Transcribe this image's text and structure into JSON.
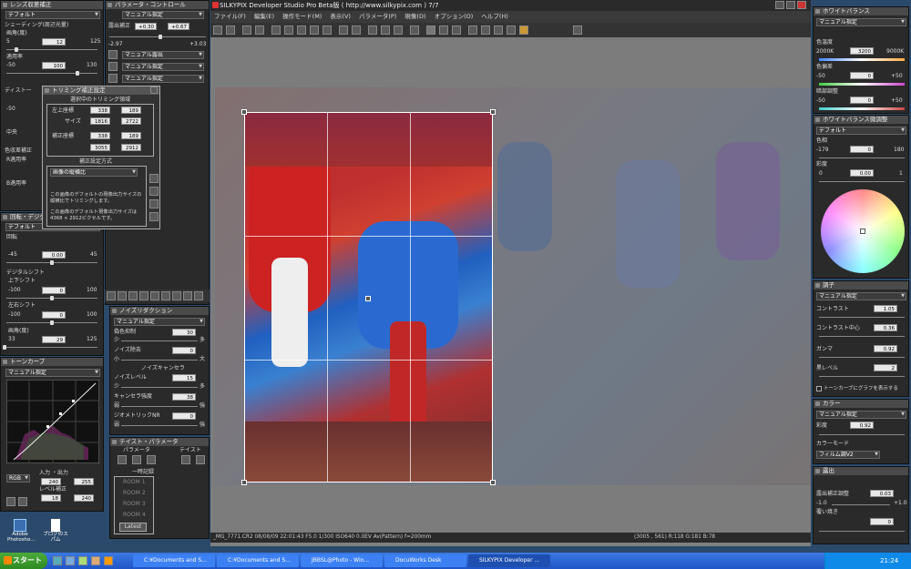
{
  "app": {
    "title": "SILKYPIX Developer Studio Pro Beta版 ( http://www.silkypix.com ) 7/7"
  },
  "menu": [
    "ファイル(F)",
    "編集(E)",
    "操作モード(M)",
    "表示(V)",
    "パラメータ(P)",
    "現像(D)",
    "オプション(O)",
    "ヘルプ(H)"
  ],
  "status": {
    "left": "_MG_7771.CR2 08/08/09 22:01:43 F5.0 1/300 ISO640 0.0EV Av(Pattern) f=200mm",
    "right": "(3005 , 561) R:118 G:181 B:78"
  },
  "lens": {
    "title": "レンズ収差補正",
    "preset": "デフォルト",
    "shading": "シェーディング(周辺光量)",
    "angle_label": "画角(度)",
    "angle_min": "5",
    "angle_val": "12",
    "angle_max": "125",
    "rate_label": "適用率",
    "rate_min": "-50",
    "rate_val": "100",
    "rate_max": "130",
    "distortion": "ディストー",
    "dist_min": "-50",
    "center": "中央",
    "chrom": "色収差補正",
    "r_rate": "R適用率",
    "b_rate": "B適用率"
  },
  "trim": {
    "title": "トリミング補正設定",
    "section": "選択中のトリミング領域",
    "tl_label": "左上座標",
    "tl_x": "338",
    "tl_y": "189",
    "size_label": "サイズ",
    "size_w": "1816",
    "size_h": "2722",
    "coord_label": "補正座標",
    "cx": "338",
    "cy": "189",
    "ex": "3055",
    "ey": "2912",
    "method_title": "補正設定方式",
    "method": "画像の縦横比",
    "info1": "この画像のデフォルトの現像出力サイズの縦横比でトリミングします。",
    "info2": "この画像のデフォルト現像出力サイズは 4368 × 2912ピクセルです。"
  },
  "rotate": {
    "title": "回転・デジタルシフト",
    "preset": "デフォルト",
    "rotate_label": "回転",
    "min": "-45",
    "val": "0.00",
    "max": "45",
    "shift_label": "デジタルシフト",
    "ud_label": "上下シフト",
    "ud_min": "-100",
    "ud_val": "0",
    "ud_max": "100",
    "lr_label": "左右シフト",
    "lr_min": "-100",
    "lr_val": "0",
    "lr_max": "100",
    "angle_label": "画角(度)",
    "angle_min": "33",
    "angle_val": "29",
    "angle_max": "125"
  },
  "tone": {
    "title": "トーンカーブ",
    "preset": "マニュアル指定",
    "channel": "RGB",
    "io_label": "入力 ・出力",
    "in_val": "240",
    "out_val": "255",
    "level_label": "レベル補正",
    "lv1": "18",
    "lv2": "240"
  },
  "param": {
    "title": "パラメータ・コントロール",
    "exposure_label": "露出補正",
    "exp_val1": "+0.30",
    "exp_val2": "+0.67",
    "exp_min": "-2.97",
    "exp_max": "+3.03",
    "sel1": "マニュアル指定",
    "sel2": "マニュアル露出",
    "sel3": "マニュアル指定",
    "sel4": "マニュアル指定"
  },
  "noise": {
    "title": "ノイズリダクション",
    "preset": "マニュアル指定",
    "color_label": "偽色抑制",
    "color_val": "30",
    "noise_label": "ノイズ除去",
    "noise_val": "0",
    "small": "小",
    "large": "大",
    "cancel_title": "ノイズキャンセラ",
    "level_label": "ノイズレベル",
    "level_val": "15",
    "weak": "弱",
    "strong": "強",
    "few": "少",
    "many": "多",
    "canceler_label": "キャンセラ強度",
    "canceler_val": "38",
    "geo_label": "ジオメトリックNR",
    "geo_val": "0"
  },
  "taste": {
    "title": "テイスト・パラメータ",
    "param_label": "パラメータ",
    "taste_label": "テイスト",
    "temp_label": "一時記録",
    "rooms": [
      "ROOM 1",
      "ROOM 2",
      "ROOM 3",
      "ROOM 4"
    ],
    "latest": "Latest"
  },
  "wb": {
    "title": "ホワイトバランス",
    "preset": "マニュアル指定",
    "temp_label": "色温度",
    "temp_min": "2000K",
    "temp_val": "3200",
    "temp_max": "9000K",
    "cast_label": "色偏差",
    "cast_min": "-50",
    "cast_val": "0",
    "cast_max": "+50",
    "dark_label": "暗部調整",
    "dark_min": "-50",
    "dark_val": "0",
    "dark_max": "+50"
  },
  "wbadj": {
    "title": "ホワイトバランス微調整",
    "preset": "デフォルト",
    "hue_label": "色相",
    "hue_min": "-179",
    "hue_val": "0",
    "hue_max": "180",
    "sat_label": "彩度",
    "sat_min": "0",
    "sat_val": "0.00",
    "sat_max": "1"
  },
  "toneadj": {
    "title": "調子",
    "preset": "マニュアル指定",
    "contrast_label": "コントラスト",
    "contrast_val": "1.05",
    "center_label": "コントラスト中心",
    "center_val": "0.36",
    "gamma_label": "ガンマ",
    "gamma_val": "0.92",
    "black_label": "黒レベル",
    "black_val": "2",
    "curve_check": "トーンカーブにグラフを表示する"
  },
  "color": {
    "title": "カラー",
    "preset": "マニュアル指定",
    "sat_label": "彩度",
    "sat_val": "0.92",
    "mode_label": "カラーモード",
    "mode": "フィルム調V2"
  },
  "exposure": {
    "title": "露出",
    "ex_label": "露出補正調整",
    "ex_min": "-1.0",
    "ex_val": "0.03",
    "ex_max": "+1.0",
    "hl_label": "覆い焼き",
    "hl_val": "0"
  },
  "desktop": {
    "icon1": "Adobe Photosho...",
    "icon2": "ブログのスパム"
  },
  "taskbar": {
    "start": "スタート",
    "items": [
      "C:¥Documents and S...",
      "C:¥Documents and S...",
      "JBBSL@Photo - Win...",
      "DocuWorks Desk",
      "SILKYPIX Developer ..."
    ],
    "clock": "21:24"
  },
  "chart_data": null
}
